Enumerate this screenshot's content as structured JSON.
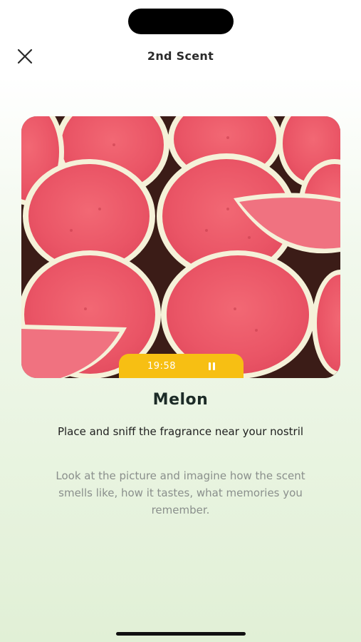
{
  "header": {
    "title": "2nd Scent",
    "close_icon": "close-icon"
  },
  "image": {
    "subject": "watermelon-slices",
    "colors": {
      "flesh": "#ee5a6a",
      "rind": "#f4f1d8",
      "shadow": "#3a1a15"
    }
  },
  "player": {
    "timer": "19:58",
    "pause_icon": "pause-icon",
    "accent": "#f7bf13"
  },
  "scent": {
    "name": "Melon",
    "instruction": "Place and sniff the fragrance near your nostril",
    "description": "Look at the picture and imagine how the scent smells like, how it tastes, what memories you remember."
  }
}
